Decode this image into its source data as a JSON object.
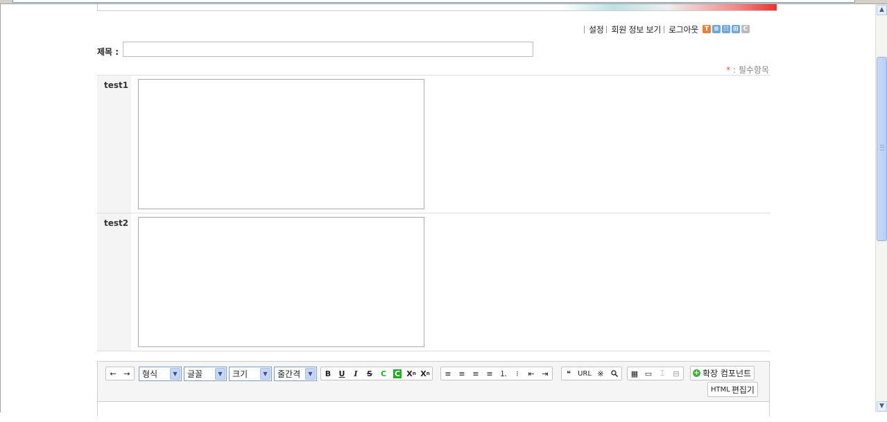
{
  "top_menu": {
    "settings": "설정",
    "member_info": "회원 정보 보기",
    "logout": "로그아웃",
    "skin_icons": [
      {
        "letter": "T",
        "color": "#e8813a",
        "icon": "text-skin-icon"
      },
      {
        "letter": "≡",
        "color": "#6fa7d8",
        "icon": "list-skin-icon"
      },
      {
        "letter": "☷",
        "color": "#6fa7d8",
        "icon": "webzine-skin-icon"
      },
      {
        "letter": "⊞",
        "color": "#6fa7d8",
        "icon": "gallery-skin-icon"
      },
      {
        "letter": "C",
        "color": "#bbbbbb",
        "icon": "cloud-skin-icon"
      }
    ]
  },
  "form": {
    "title_label": "제목 :",
    "title_value": "",
    "required_star": "*",
    "required_text": " : 필수항목",
    "fields": [
      {
        "label": "test1",
        "value": ""
      },
      {
        "label": "test2",
        "value": ""
      }
    ]
  },
  "editor": {
    "nav": {
      "undo": "←",
      "redo": "→"
    },
    "selects": {
      "format": "형식",
      "font": "글꼴",
      "size": "크기",
      "line_height": "줄간격"
    },
    "style_buttons": {
      "bold": "B",
      "underline": "U",
      "italic": "I",
      "strike": "S",
      "font_color": "C",
      "bg_color": "C",
      "sup": "X",
      "sub": "X"
    },
    "align_buttons": [
      "≡",
      "≡",
      "≡",
      "≡",
      "⒈",
      "⁝",
      "⇤",
      "⇥"
    ],
    "insert_buttons": {
      "quote": "❝",
      "url": "URL",
      "special_char": "※",
      "find": "🔍"
    },
    "table_buttons": [
      "▦",
      "▭",
      "⌶",
      "⊟"
    ],
    "extension": "확장 컴포넌트",
    "html_prefix": "HTML",
    "html_editor": "편집기"
  }
}
